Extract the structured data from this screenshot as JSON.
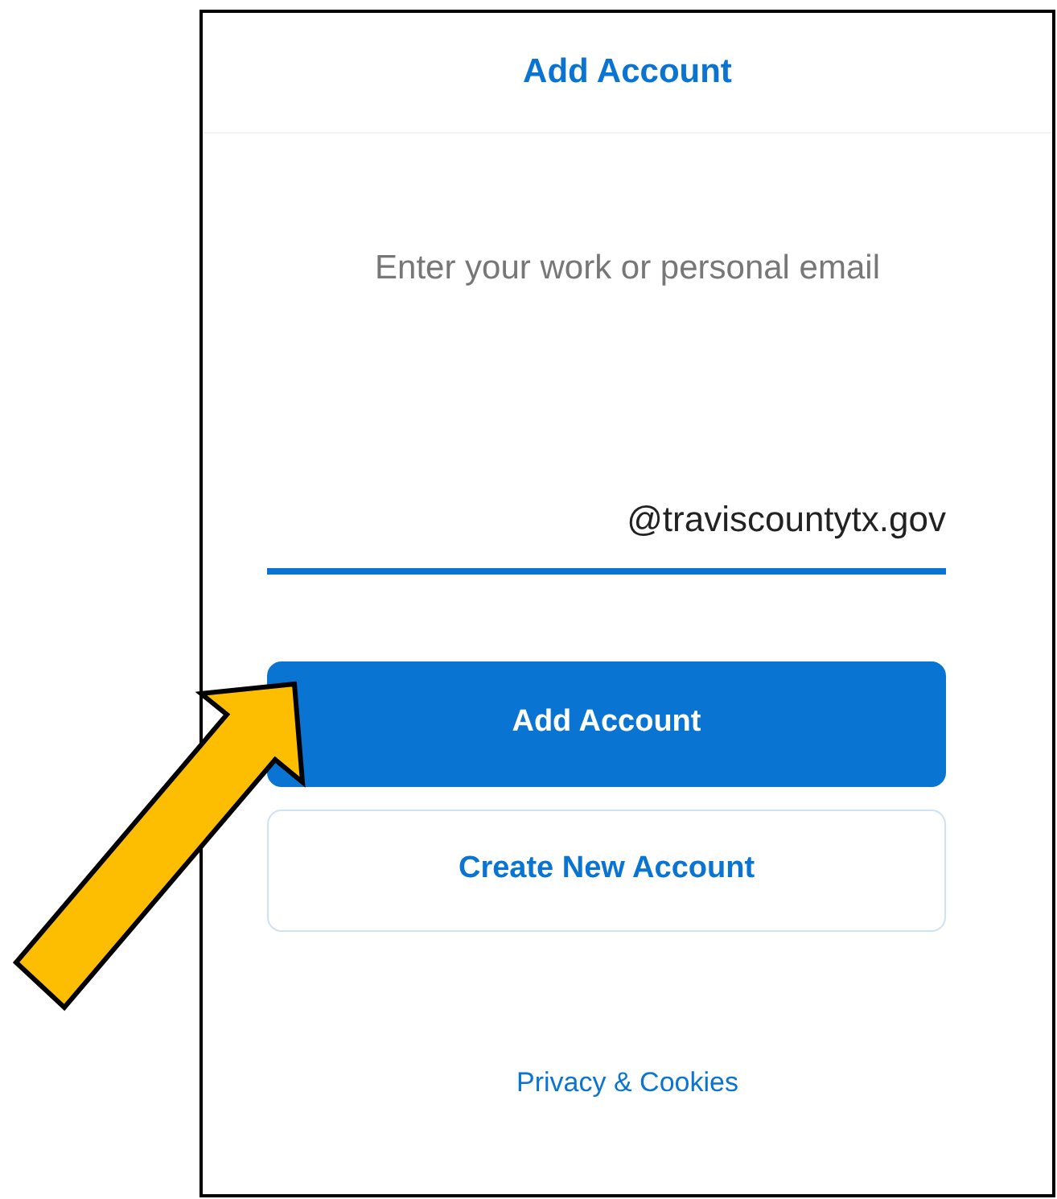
{
  "header": {
    "title": "Add Account"
  },
  "prompt": "Enter your work or personal email",
  "email_field": {
    "value": "@traviscountytx.gov"
  },
  "buttons": [
    {
      "label": "Add Account",
      "kind": "primary"
    },
    {
      "label": "Create New Account",
      "kind": "outline"
    }
  ],
  "footer_link": "Privacy & Cookies"
}
